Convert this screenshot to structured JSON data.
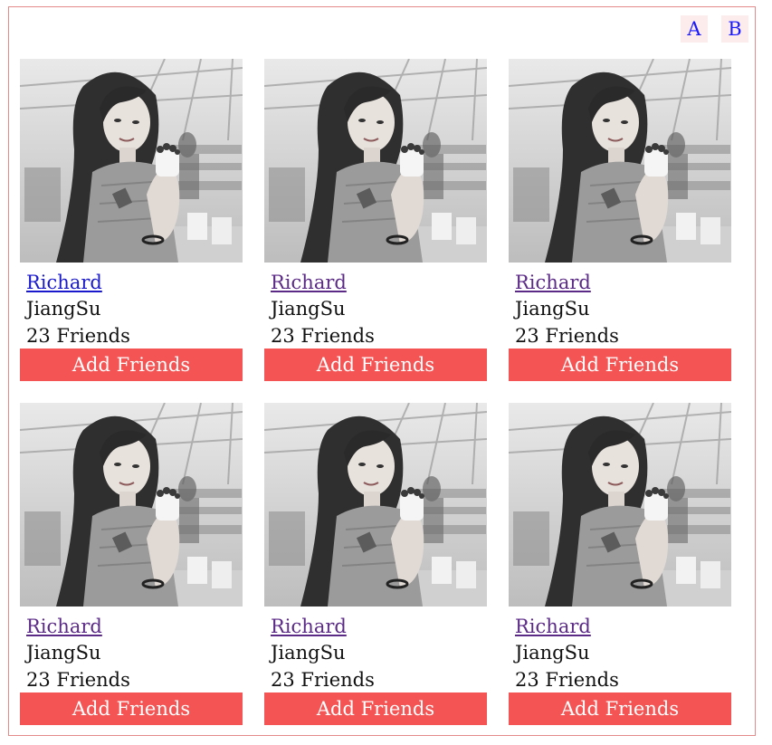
{
  "toggles": [
    {
      "label": "A"
    },
    {
      "label": "B"
    }
  ],
  "colors": {
    "accent": "#f45454",
    "border": "#e58a8a",
    "toggle_bg": "#fdecec",
    "toggle_text": "#1a1aff"
  },
  "cards": [
    {
      "name": "Richard",
      "location": "JiangSu",
      "friends": "23 Friends",
      "button": "Add Friends",
      "photo_icon": "profile-photo"
    },
    {
      "name": "Richard",
      "location": "JiangSu",
      "friends": "23 Friends",
      "button": "Add Friends",
      "photo_icon": "profile-photo"
    },
    {
      "name": "Richard",
      "location": "JiangSu",
      "friends": "23 Friends",
      "button": "Add Friends",
      "photo_icon": "profile-photo"
    },
    {
      "name": "Richard",
      "location": "JiangSu",
      "friends": "23 Friends",
      "button": "Add Friends",
      "photo_icon": "profile-photo"
    },
    {
      "name": "Richard",
      "location": "JiangSu",
      "friends": "23 Friends",
      "button": "Add Friends",
      "photo_icon": "profile-photo"
    },
    {
      "name": "Richard",
      "location": "JiangSu",
      "friends": "23 Friends",
      "button": "Add Friends",
      "photo_icon": "profile-photo"
    }
  ]
}
